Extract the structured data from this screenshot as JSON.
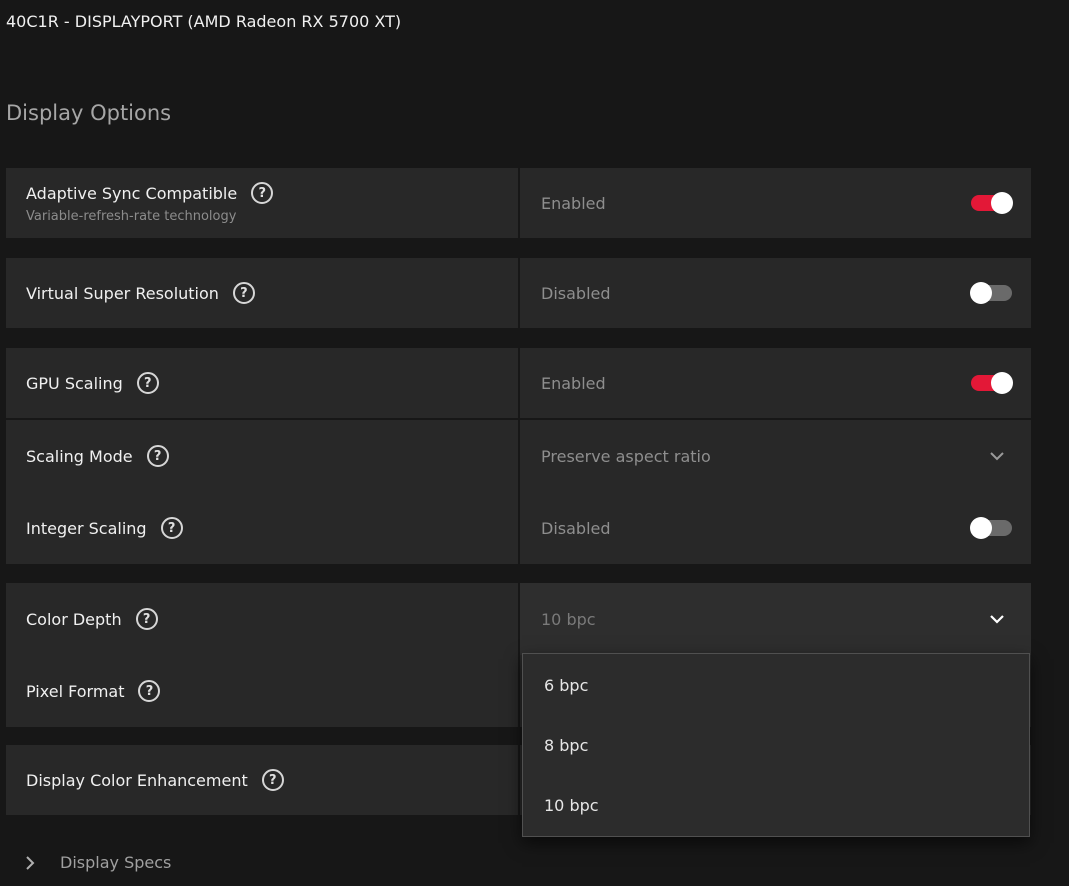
{
  "header": {
    "title": "40C1R - DISPLAYPORT (AMD Radeon RX 5700 XT)"
  },
  "section": {
    "title": "Display Options"
  },
  "settings": {
    "adaptive_sync": {
      "label": "Adaptive Sync Compatible",
      "sublabel": "Variable-refresh-rate technology",
      "value": "Enabled",
      "state": "on"
    },
    "vsr": {
      "label": "Virtual Super Resolution",
      "value": "Disabled",
      "state": "off"
    },
    "gpu_scaling": {
      "label": "GPU Scaling",
      "value": "Enabled",
      "state": "on"
    },
    "scaling_mode": {
      "label": "Scaling Mode",
      "value": "Preserve aspect ratio"
    },
    "integer_scaling": {
      "label": "Integer Scaling",
      "value": "Disabled",
      "state": "off"
    },
    "color_depth": {
      "label": "Color Depth",
      "value": "10 bpc"
    },
    "pixel_format": {
      "label": "Pixel Format"
    },
    "display_color_enhancement": {
      "label": "Display Color Enhancement"
    }
  },
  "color_depth_options": [
    "6 bpc",
    "8 bpc",
    "10 bpc"
  ],
  "footer": {
    "display_specs": "Display Specs"
  },
  "icons": {
    "help": "?",
    "help_name": "help-circle-icon",
    "chevron": "chevron-down-icon",
    "expand": "chevron-right-icon"
  },
  "colors": {
    "accent": "#e31837",
    "toggle_off": "#6a6a6a",
    "background": "#171717",
    "row": "#282828"
  }
}
